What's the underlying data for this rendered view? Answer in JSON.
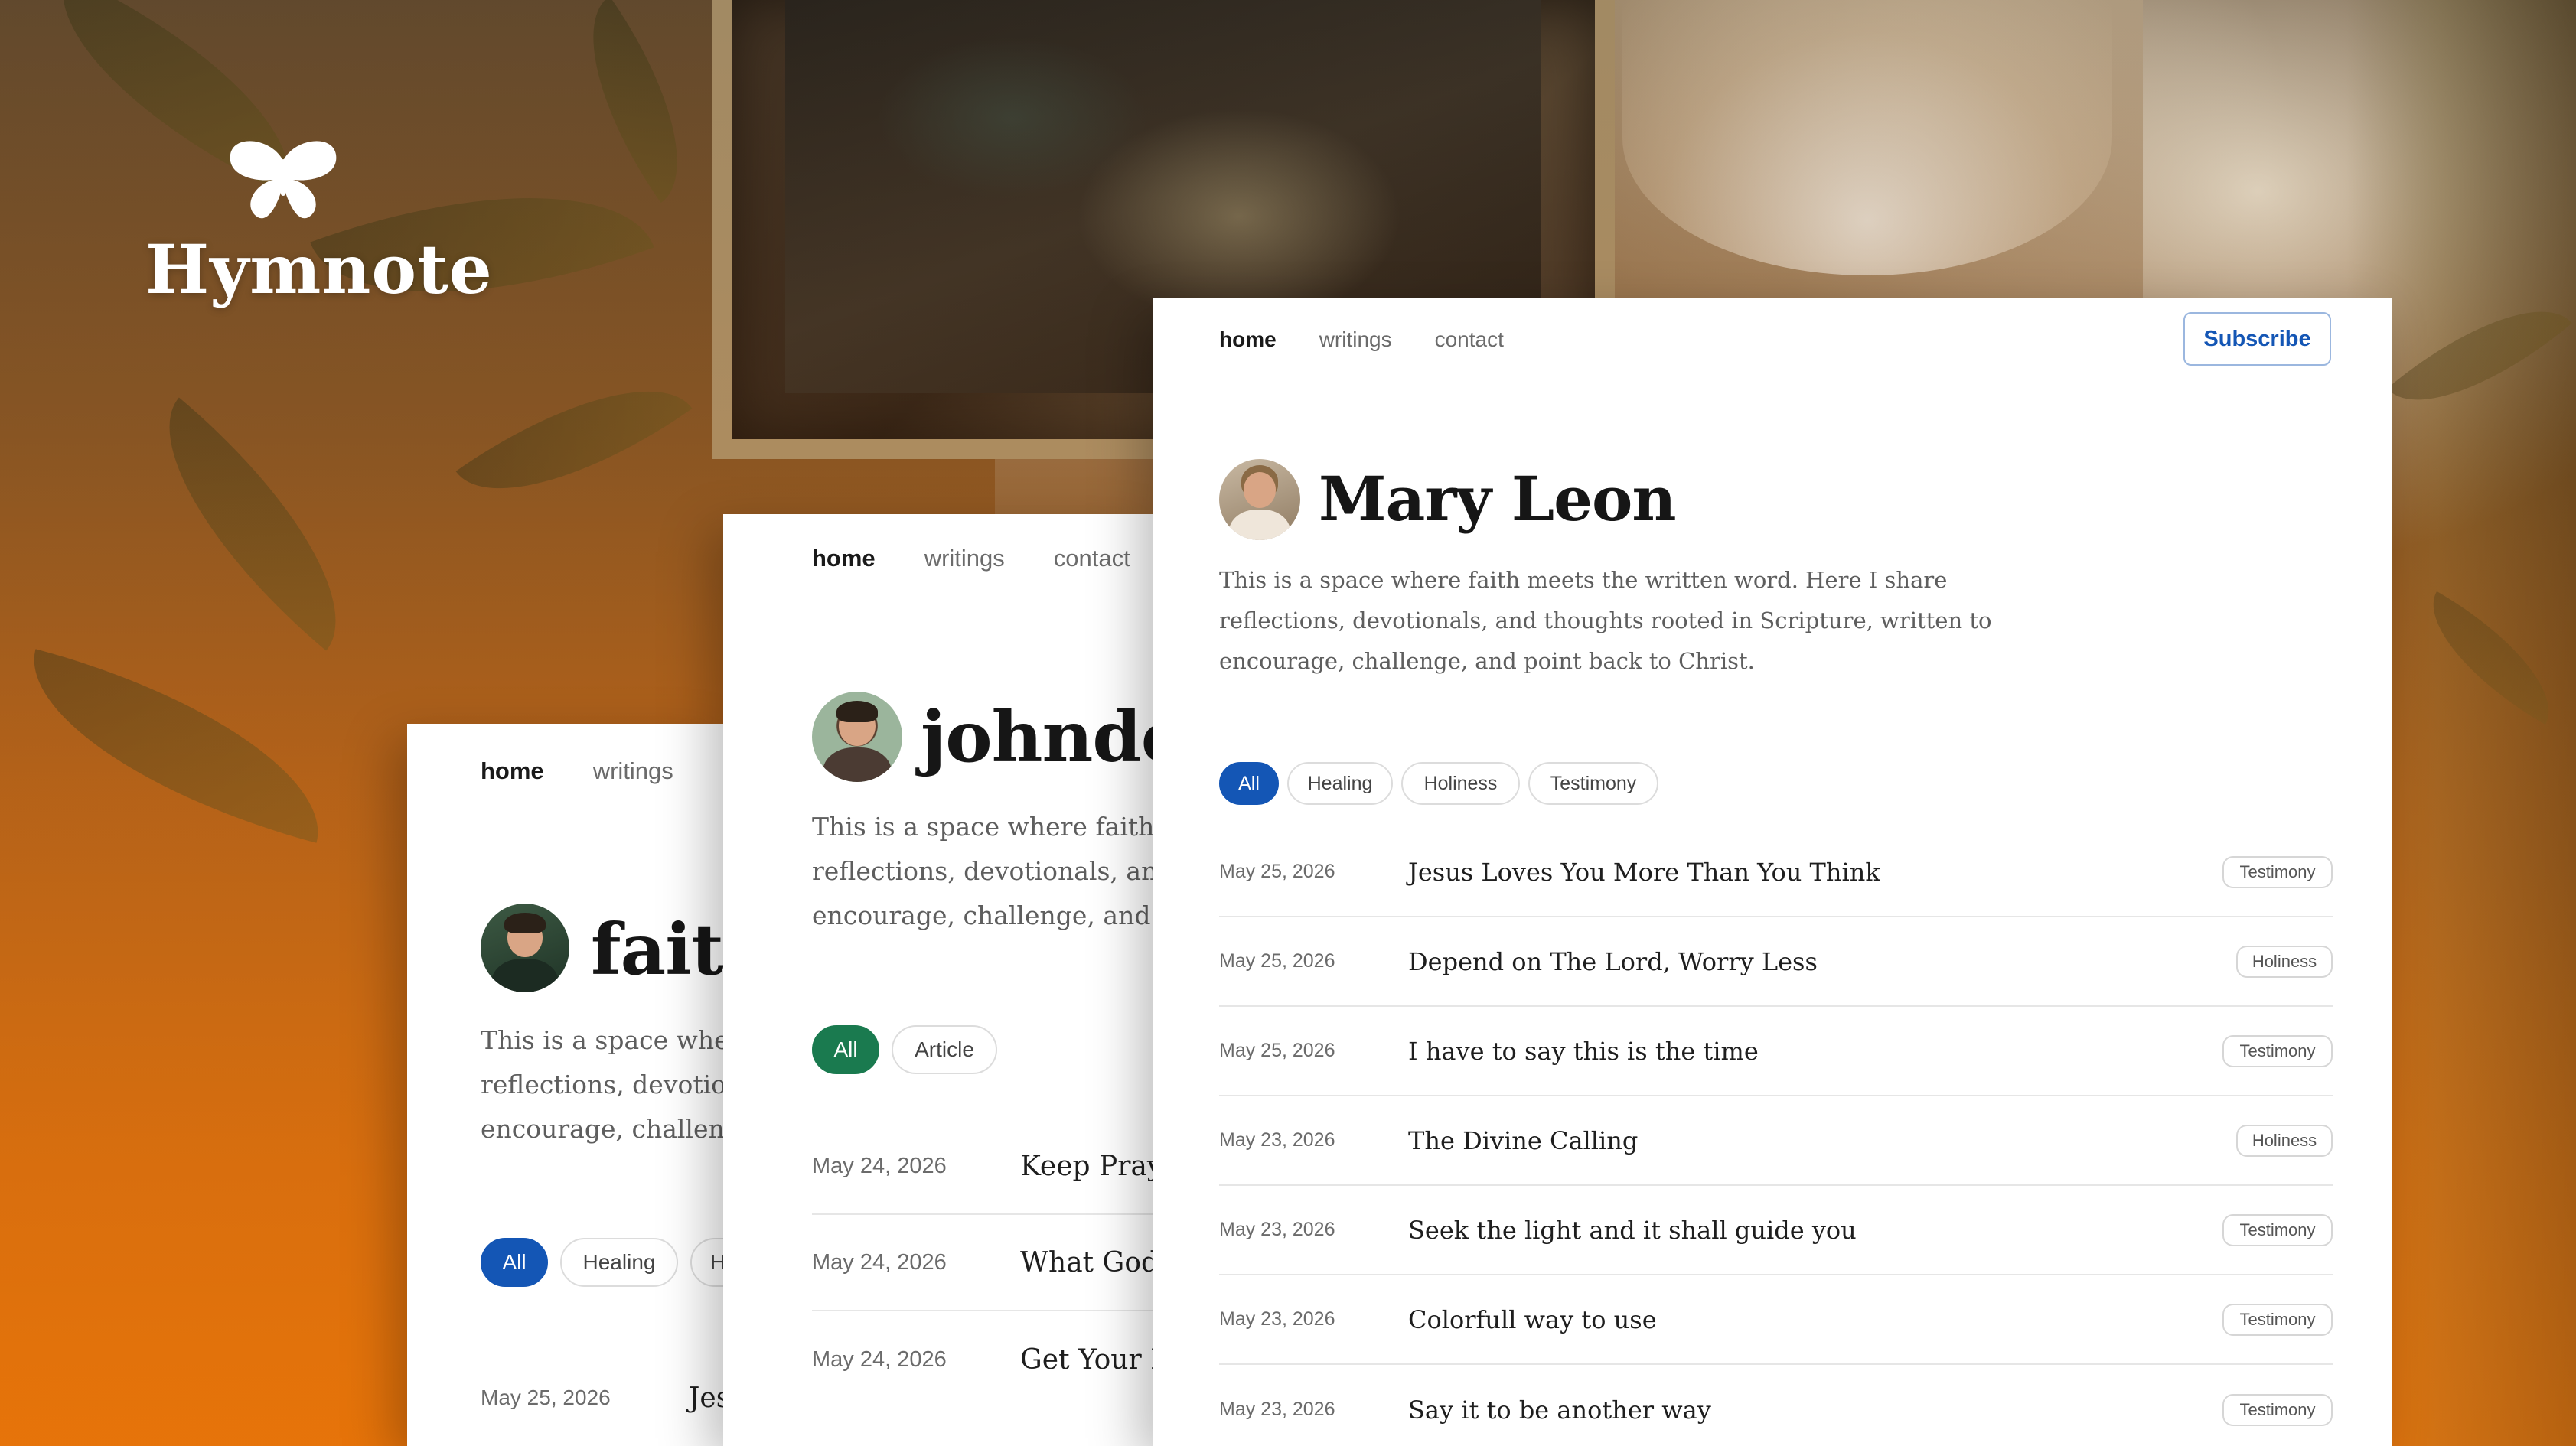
{
  "brand": {
    "name": "Hymnote",
    "logo_icon": "butterfly-icon"
  },
  "colors": {
    "accent_blue": "#1456b5",
    "accent_green": "#1a7a4f",
    "background_orange": "#e77809"
  },
  "card_front": {
    "nav": {
      "home": "home",
      "writings": "writings",
      "contact": "contact"
    },
    "subscribe_label": "Subscribe",
    "author_name": "Mary Leon",
    "bio_lines": [
      "This is a space where faith meets the written word. Here I share",
      "reflections, devotionals, and thoughts rooted in Scripture, written to",
      "encourage, challenge, and point back to Christ."
    ],
    "filters": [
      "All",
      "Healing",
      "Holiness",
      "Testimony"
    ],
    "active_filter": "All",
    "posts": [
      {
        "date": "May 25, 2026",
        "title": "Jesus Loves You More Than You Think",
        "tag": "Testimony"
      },
      {
        "date": "May 25, 2026",
        "title": "Depend on The Lord, Worry Less",
        "tag": "Holiness"
      },
      {
        "date": "May 25, 2026",
        "title": "I have to say this is the time",
        "tag": "Testimony"
      },
      {
        "date": "May 23, 2026",
        "title": "The Divine Calling",
        "tag": "Holiness"
      },
      {
        "date": "May 23, 2026",
        "title": "Seek the light and it shall guide you",
        "tag": "Testimony"
      },
      {
        "date": "May 23, 2026",
        "title": "Colorfull way to use",
        "tag": "Testimony"
      },
      {
        "date": "May 23, 2026",
        "title": "Say it to be another way",
        "tag": "Testimony"
      }
    ]
  },
  "card_middle": {
    "nav": {
      "home": "home",
      "writings": "writings",
      "contact": "contact"
    },
    "author_name": "johndoe",
    "bio_lines": [
      "This is a space where faith m",
      "reflections, devotionals, and t",
      "encourage, challenge, and po"
    ],
    "filters": [
      "All",
      "Article"
    ],
    "active_filter": "All",
    "posts": [
      {
        "date": "May 24, 2026",
        "title": "Keep Prayi"
      },
      {
        "date": "May 24, 2026",
        "title": "What God I"
      },
      {
        "date": "May 24, 2026",
        "title": "Get Your H"
      }
    ]
  },
  "card_back": {
    "nav": {
      "home": "home",
      "writings": "writings"
    },
    "author_name": "faith",
    "bio_lines": [
      "This is a space wher",
      "reflections, devotion",
      "encourage, challeng"
    ],
    "filters": [
      "All",
      "Healing",
      "H"
    ],
    "active_filter": "All",
    "posts": [
      {
        "date": "May 25, 2026",
        "title": "Jes"
      }
    ]
  }
}
